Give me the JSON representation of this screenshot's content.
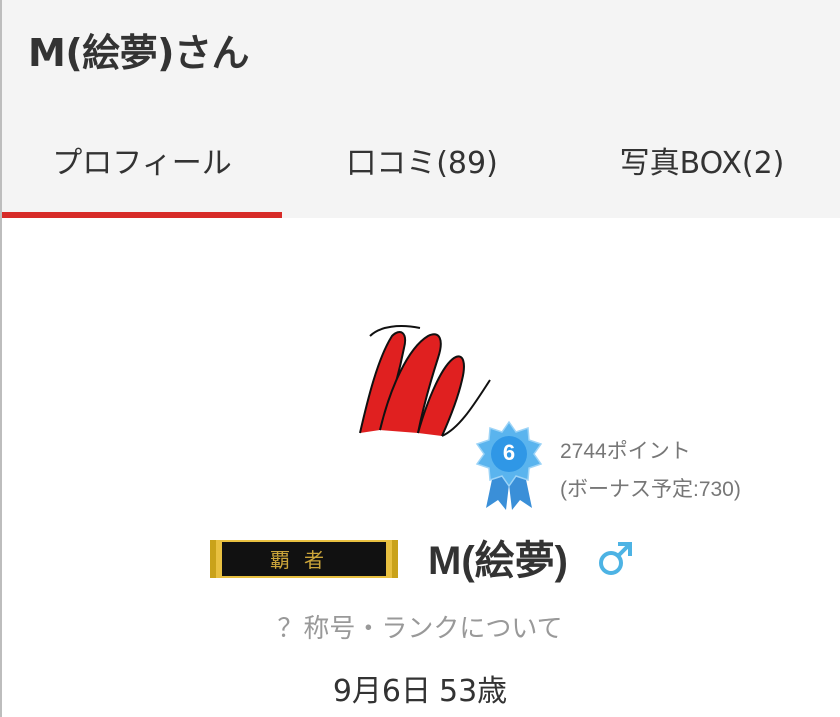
{
  "header": {
    "title": "M(絵夢)さん"
  },
  "tabs": [
    {
      "label": "プロフィール",
      "active": true
    },
    {
      "label": "口コミ(89)",
      "active": false
    },
    {
      "label": "写真BOX(2)",
      "active": false
    }
  ],
  "profile": {
    "avatar_icon": "calligraphy-m-logo",
    "rank_level": "6",
    "points_text": "2744ポイント",
    "bonus_text": "(ボーナス予定:730)",
    "title_badge_text": "覇者",
    "name": "M(絵夢)",
    "gender_icon": "male-icon",
    "rank_link_text": "？称号・ランクについて",
    "birthday": "9月6日",
    "age": "53歳"
  },
  "colors": {
    "accent": "#d72b28",
    "gender": "#4db3e4",
    "badge": "#3aa0e0"
  }
}
